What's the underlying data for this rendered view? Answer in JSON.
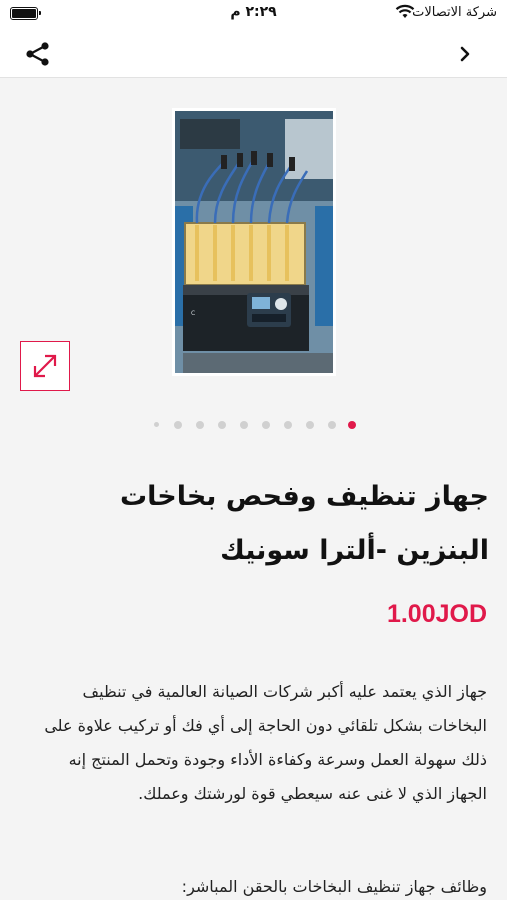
{
  "status_bar": {
    "carrier": "شركة الاتصالات",
    "time": "٢:٢٩ م"
  },
  "nav": {
    "share_icon": "share-icon",
    "back_icon": "chevron-right-icon"
  },
  "gallery": {
    "image_description": "fuel injector cleaning machine",
    "expand_icon": "expand-arrows-icon",
    "page_count": 10,
    "active_index": 0
  },
  "product": {
    "title": "جهاز تنظيف وفحص بخاخات البنزين -ألترا سونيك",
    "price": "1.00JOD",
    "description": "جهاز الذي يعتمد عليه أكبر شركات الصيانة العالمية في تنظيف البخاخات بشكل تلقائي دون الحاجة إلى أي فك أو تركيب علاوة على ذلك سهولة العمل وسرعة وكفاءة الأداء وجودة وتحمل المنتج إنه الجهاز الذي لا غنى عنه سيعطي قوة لورشتك وعملك.",
    "functions_heading": "وظائف جهاز تنظيف البخاخات بالحقن المباشر:"
  },
  "colors": {
    "accent": "#e0194a",
    "background": "#f4f4f4"
  }
}
